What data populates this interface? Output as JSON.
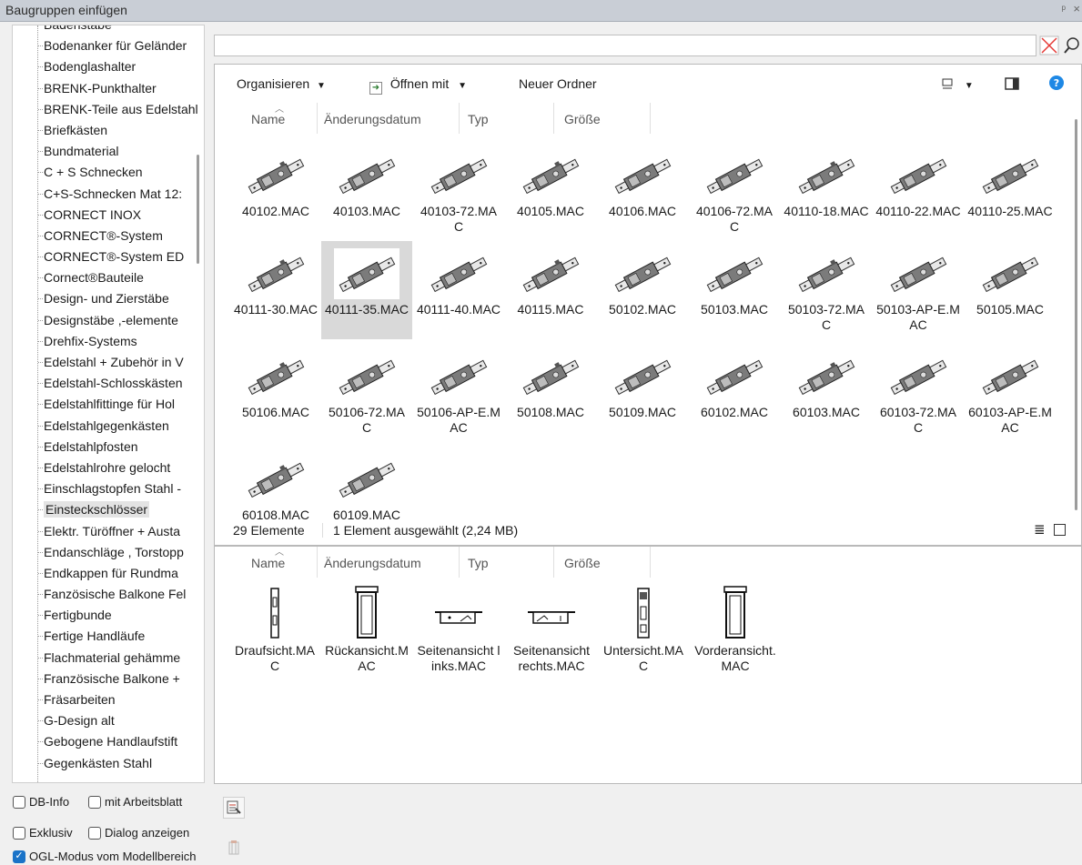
{
  "window": {
    "title": "Baugruppen einfügen",
    "pin_glyph": "ᵖ",
    "close_glyph": "×"
  },
  "tree": {
    "items": [
      "Badenstäbe",
      "Bodenanker für Geländer",
      "Bodenglashalter",
      "BRENK-Punkthalter",
      "BRENK-Teile aus Edelstahl",
      "Briefkästen",
      "Bundmaterial",
      "C + S Schnecken",
      "C+S-Schnecken Mat 12:",
      "CORNECT INOX",
      "CORNECT®-System",
      "CORNECT®-System ED",
      "Cornect®Bauteile",
      "Design- und Zierstäbe",
      "Designstäbe ,-elemente",
      "Drehfix-Systems",
      "Edelstahl + Zubehör in V",
      "Edelstahl-Schlosskästen",
      "Edelstahlfittinge für Hol",
      "Edelstahlgegenkästen",
      "Edelstahlpfosten",
      "Edelstahlrohre gelocht",
      "Einschlagstopfen Stahl -",
      "Einsteckschlösser",
      "Elektr. Türöffner + Austa",
      "Endanschläge , Torstopp",
      "Endkappen für Rundma",
      "Fanzösische Balkone Fel",
      "Fertigbunde",
      "Fertige Handläufe",
      "Flachmaterial gehämme",
      "Französische Balkone +",
      "Fräsarbeiten",
      "G-Design alt",
      "Gebogene Handlaufstift",
      "Gegenkästen Stahl"
    ],
    "selected_index": 23
  },
  "options": {
    "db_info": "DB-Info",
    "mit_arbeitsblatt": "mit Arbeitsblatt",
    "exklusiv": "Exklusiv",
    "dialog_anzeigen": "Dialog anzeigen",
    "ogl_modus": "OGL-Modus vom Modellbereich",
    "ogl_checked": true
  },
  "search": {
    "value": ""
  },
  "explorer": {
    "organize": "Organisieren",
    "open_with": "Öffnen mit",
    "new_folder": "Neuer Ordner",
    "columns": [
      "Name",
      "Änderungsdatum",
      "Typ",
      "Größe"
    ],
    "files": [
      "40102.MAC",
      "40103.MAC",
      "40103-72.MAC",
      "40105.MAC",
      "40106.MAC",
      "40106-72.MAC",
      "40110-18.MAC",
      "40110-22.MAC",
      "40110-25.MAC",
      "40111-30.MAC",
      "40111-35.MAC",
      "40111-40.MAC",
      "40115.MAC",
      "50102.MAC",
      "50103.MAC",
      "50103-72.MAC",
      "50103-AP-E.MAC",
      "50105.MAC",
      "50106.MAC",
      "50106-72.MAC",
      "50106-AP-E.MAC",
      "50108.MAC",
      "50109.MAC",
      "60102.MAC",
      "60103.MAC",
      "60103-72.MAC",
      "60103-AP-E.MAC",
      "60108.MAC",
      "60109.MAC"
    ],
    "selected_file_index": 10,
    "status_count": "29 Elemente",
    "status_selection": "1 Element ausgewählt (2,24 MB)"
  },
  "views": {
    "columns": [
      "Name",
      "Änderungsdatum",
      "Typ",
      "Größe"
    ],
    "files": [
      "Draufsicht.MAC",
      "Rückansicht.MAC",
      "Seitenansicht links.MAC",
      "Seitenansicht rechts.MAC",
      "Untersicht.MAC",
      "Vorderansicht.MAC"
    ]
  },
  "colors": {
    "selection": "#d9d9d9",
    "checkbox_on": "#1a73c8",
    "help": "#1e88e5",
    "clear_x": "#e53935"
  }
}
